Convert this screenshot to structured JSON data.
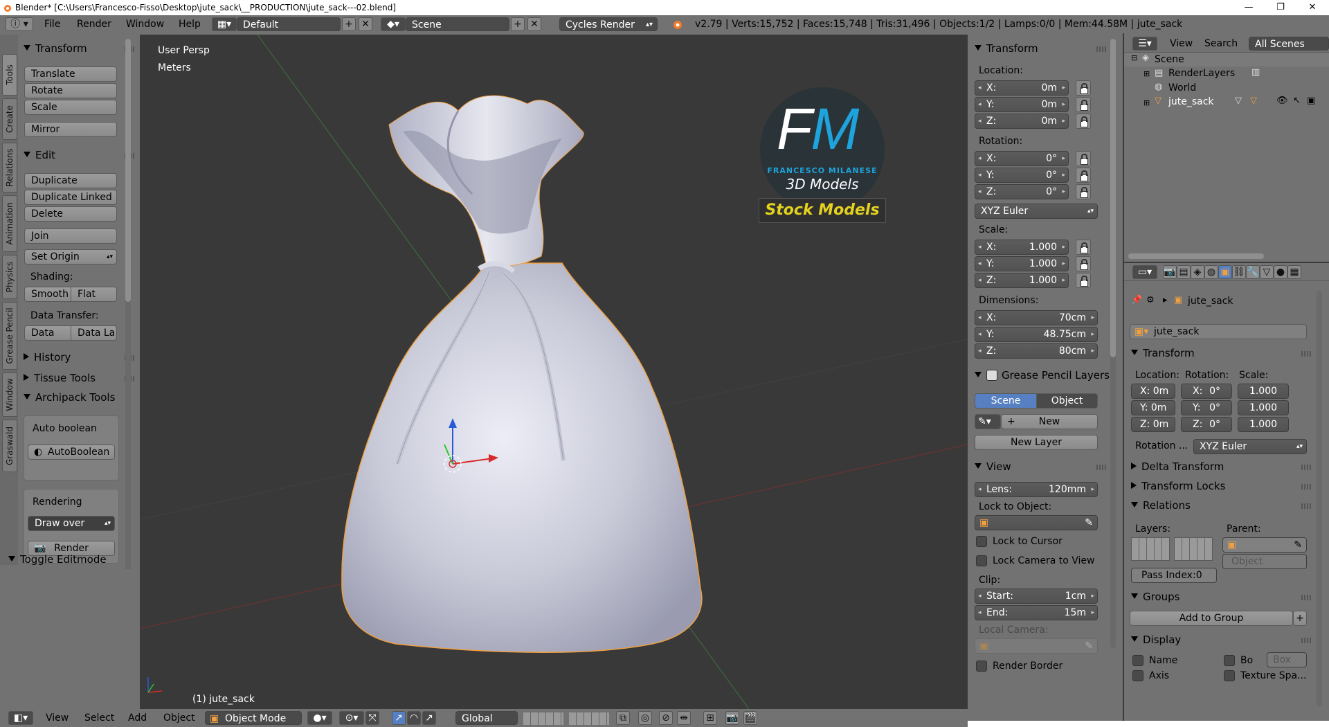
{
  "window": {
    "title": "Blender* [C:\\Users\\Francesco-Fisso\\Desktop\\jute_sack\\__PRODUCTION\\jute_sack---02.blend]",
    "minimize": "—",
    "maximize": "❐",
    "close": "✕"
  },
  "topbar": {
    "menus": [
      "File",
      "Render",
      "Window",
      "Help"
    ],
    "layout": "Default",
    "scene": "Scene",
    "engine": "Cycles Render",
    "stats": "v2.79 | Verts:15,752 | Faces:15,748 | Tris:31,496 | Objects:1/2 | Lamps:0/0 | Mem:44.58M | jute_sack"
  },
  "tool_tabs": [
    "Tools",
    "Create",
    "Relations",
    "Animation",
    "Physics",
    "Grease Pencil",
    "Window",
    "Graswald"
  ],
  "toolshelf": {
    "transform_header": "Transform",
    "transform_buttons": [
      "Translate",
      "Rotate",
      "Scale"
    ],
    "mirror": "Mirror",
    "edit_header": "Edit",
    "edit_buttons": [
      "Duplicate",
      "Duplicate Linked",
      "Delete"
    ],
    "join": "Join",
    "set_origin": "Set Origin",
    "shading_label": "Shading:",
    "smooth": "Smooth",
    "flat": "Flat",
    "data_transfer_label": "Data Transfer:",
    "data": "Data",
    "data_la": "Data La",
    "history": "History",
    "tissue": "Tissue Tools",
    "archipack": "Archipack Tools",
    "auto_boolean_label": "Auto boolean",
    "auto_boolean_btn": "AutoBoolean",
    "rendering_label": "Rendering",
    "draw_over": "Draw over",
    "render": "Render",
    "toggle_editmode": "Toggle Editmode"
  },
  "viewport": {
    "view_name": "User Persp",
    "units": "Meters",
    "object_label": "(1) jute_sack",
    "logo": {
      "initials": "FM",
      "name": "FRANCESCO MILANESE",
      "sub": "3D Models",
      "badge": "Stock Models"
    }
  },
  "bottombar": {
    "view": "View",
    "select": "Select",
    "add": "Add",
    "object": "Object",
    "mode": "Object Mode",
    "orientation": "Global"
  },
  "npanel": {
    "transform": "Transform",
    "location_label": "Location:",
    "location": [
      {
        "axis": "X:",
        "value": "0m"
      },
      {
        "axis": "Y:",
        "value": "0m"
      },
      {
        "axis": "Z:",
        "value": "0m"
      }
    ],
    "rotation_label": "Rotation:",
    "rotation": [
      {
        "axis": "X:",
        "value": "0°"
      },
      {
        "axis": "Y:",
        "value": "0°"
      },
      {
        "axis": "Z:",
        "value": "0°"
      }
    ],
    "rotation_mode": "XYZ Euler",
    "scale_label": "Scale:",
    "scale": [
      {
        "axis": "X:",
        "value": "1.000"
      },
      {
        "axis": "Y:",
        "value": "1.000"
      },
      {
        "axis": "Z:",
        "value": "1.000"
      }
    ],
    "dimensions_label": "Dimensions:",
    "dimensions": [
      {
        "axis": "X:",
        "value": "70cm"
      },
      {
        "axis": "Y:",
        "value": "48.75cm"
      },
      {
        "axis": "Z:",
        "value": "80cm"
      }
    ],
    "grease_pencil": "Grease Pencil Layers",
    "gp_scene": "Scene",
    "gp_object": "Object",
    "gp_new": "New",
    "gp_new_layer": "New Layer",
    "view": "View",
    "lens_label": "Lens:",
    "lens": "120mm",
    "lock_to_object": "Lock to Object:",
    "lock_to_cursor": "Lock to Cursor",
    "lock_camera": "Lock Camera to View",
    "clip": "Clip:",
    "clip_start_label": "Start:",
    "clip_start": "1cm",
    "clip_end_label": "End:",
    "clip_end": "15m",
    "local_camera": "Local Camera:",
    "render_border": "Render Border"
  },
  "outliner": {
    "view": "View",
    "search": "Search",
    "all_scenes": "All Scenes",
    "items": [
      "Scene",
      "RenderLayers",
      "World",
      "jute_sack"
    ]
  },
  "properties": {
    "object_name_breadcrumb": "jute_sack",
    "object_name_field": "jute_sack",
    "transform": "Transform",
    "location_label": "Location:",
    "rotation_label": "Rotation:",
    "scale_label": "Scale:",
    "loc": [
      "X: 0m",
      "Y: 0m",
      "Z: 0m"
    ],
    "rot_axes": [
      "X:",
      "Y:",
      "Z:"
    ],
    "rot_vals": [
      "0°",
      "0°",
      "0°"
    ],
    "scl": [
      "1.000",
      "1.000",
      "1.000"
    ],
    "rotation_mode_label": "Rotation ...",
    "rotation_mode": "XYZ Euler",
    "delta_transform": "Delta Transform",
    "transform_locks": "Transform Locks",
    "relations": "Relations",
    "layers_label": "Layers:",
    "parent_label": "Parent:",
    "parent_type": "Object",
    "pass_index": "Pass Index:0",
    "groups": "Groups",
    "add_to_group": "Add to Group",
    "display": "Display",
    "name": "Name",
    "bo": "Bo",
    "box": "Box",
    "axis": "Axis",
    "texture_space": "Texture Spa..."
  },
  "colors": {
    "accent_blue": "#5680c2",
    "logo_blue": "#1fa3dc",
    "badge_yellow": "#e4d21e",
    "selection_orange": "#f0a040",
    "viewport_bg": "#393939"
  }
}
